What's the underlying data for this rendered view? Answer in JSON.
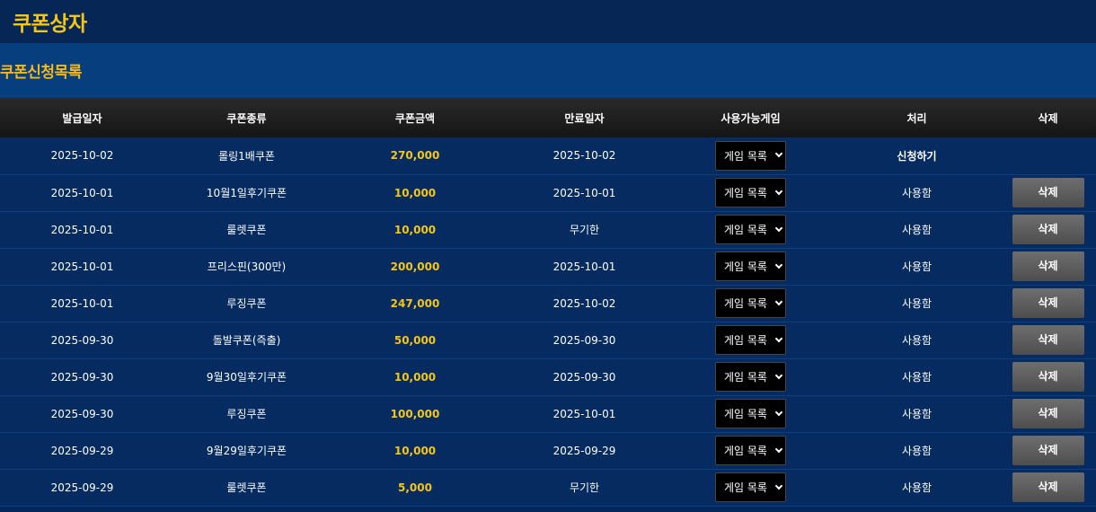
{
  "page": {
    "title": "쿠폰상자"
  },
  "section": {
    "title": "쿠폰신청목록"
  },
  "table": {
    "headers": [
      "발급일자",
      "쿠폰종류",
      "쿠폰금액",
      "만료일자",
      "사용가능게임",
      "처리",
      "삭제"
    ],
    "select_label": "게임 목록",
    "delete_label": "삭제",
    "rows": [
      {
        "issue_date": "2025-10-02",
        "type": "롤링1배쿠폰",
        "amount": "270,000",
        "expiry": "2025-10-02",
        "status": "신청하기",
        "deletable": false
      },
      {
        "issue_date": "2025-10-01",
        "type": "10월1일후기쿠폰",
        "amount": "10,000",
        "expiry": "2025-10-01",
        "status": "사용함",
        "deletable": true
      },
      {
        "issue_date": "2025-10-01",
        "type": "룰렛쿠폰",
        "amount": "10,000",
        "expiry": "무기한",
        "status": "사용함",
        "deletable": true
      },
      {
        "issue_date": "2025-10-01",
        "type": "프리스핀(300만)",
        "amount": "200,000",
        "expiry": "2025-10-01",
        "status": "사용함",
        "deletable": true
      },
      {
        "issue_date": "2025-10-01",
        "type": "루징쿠폰",
        "amount": "247,000",
        "expiry": "2025-10-02",
        "status": "사용함",
        "deletable": true
      },
      {
        "issue_date": "2025-09-30",
        "type": "돌발쿠폰(즉출)",
        "amount": "50,000",
        "expiry": "2025-09-30",
        "status": "사용함",
        "deletable": true
      },
      {
        "issue_date": "2025-09-30",
        "type": "9월30일후기쿠폰",
        "amount": "10,000",
        "expiry": "2025-09-30",
        "status": "사용함",
        "deletable": true
      },
      {
        "issue_date": "2025-09-30",
        "type": "루징쿠폰",
        "amount": "100,000",
        "expiry": "2025-10-01",
        "status": "사용함",
        "deletable": true
      },
      {
        "issue_date": "2025-09-29",
        "type": "9월29일후기쿠폰",
        "amount": "10,000",
        "expiry": "2025-09-29",
        "status": "사용함",
        "deletable": true
      },
      {
        "issue_date": "2025-09-29",
        "type": "룰렛쿠폰",
        "amount": "5,000",
        "expiry": "무기한",
        "status": "사용함",
        "deletable": true
      }
    ]
  },
  "colors": {
    "accent": "#f5c518",
    "background": "#04285a",
    "header_bar": "#062656",
    "section_bar": "#073e7d"
  }
}
